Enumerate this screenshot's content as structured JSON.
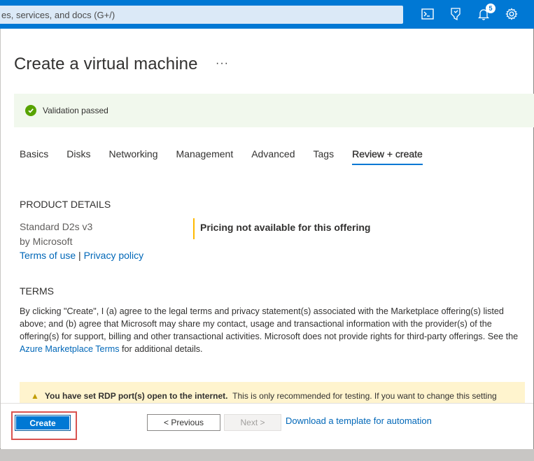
{
  "topbar": {
    "search_placeholder": "es, services, and docs (G+/)",
    "icons": [
      "cloud-shell-icon",
      "feedback-filter-icon",
      "notifications-bell-icon",
      "settings-gear-icon"
    ],
    "notification_count": "5",
    "color": "#0078d4"
  },
  "page": {
    "title": "Create a virtual machine",
    "more": "···"
  },
  "validation": {
    "text": "Validation passed",
    "color": "#57a300"
  },
  "tabs": [
    {
      "label": "Basics",
      "active": false
    },
    {
      "label": "Disks",
      "active": false
    },
    {
      "label": "Networking",
      "active": false
    },
    {
      "label": "Management",
      "active": false
    },
    {
      "label": "Advanced",
      "active": false
    },
    {
      "label": "Tags",
      "active": false
    },
    {
      "label": "Review + create",
      "active": true
    }
  ],
  "product": {
    "heading": "PRODUCT DETAILS",
    "name": "Standard D2s v3",
    "publisher": "by Microsoft",
    "terms_link": "Terms of use",
    "separator": "|",
    "privacy_link": "Privacy policy",
    "pricing": "Pricing not available for this offering"
  },
  "terms": {
    "heading": "TERMS",
    "text_before": "By clicking \"Create\", I (a) agree to the legal terms and privacy statement(s) associated with the Marketplace offering(s) listed above; and (b) agree that Microsoft may share my contact, usage and transactional information with the provider(s) of the offering(s) for support, billing and other transactional activities. Microsoft does not provide rights for third-party offerings. See the",
    "link": "Azure Marketplace Terms",
    "text_after": "for additional details."
  },
  "warning": {
    "bold": "You have set RDP port(s) open to the internet.",
    "text": "This is only recommended for testing.  If you want to change this setting"
  },
  "footer": {
    "create": "Create",
    "previous": "< Previous",
    "next": "Next >",
    "download": "Download a template for automation"
  }
}
